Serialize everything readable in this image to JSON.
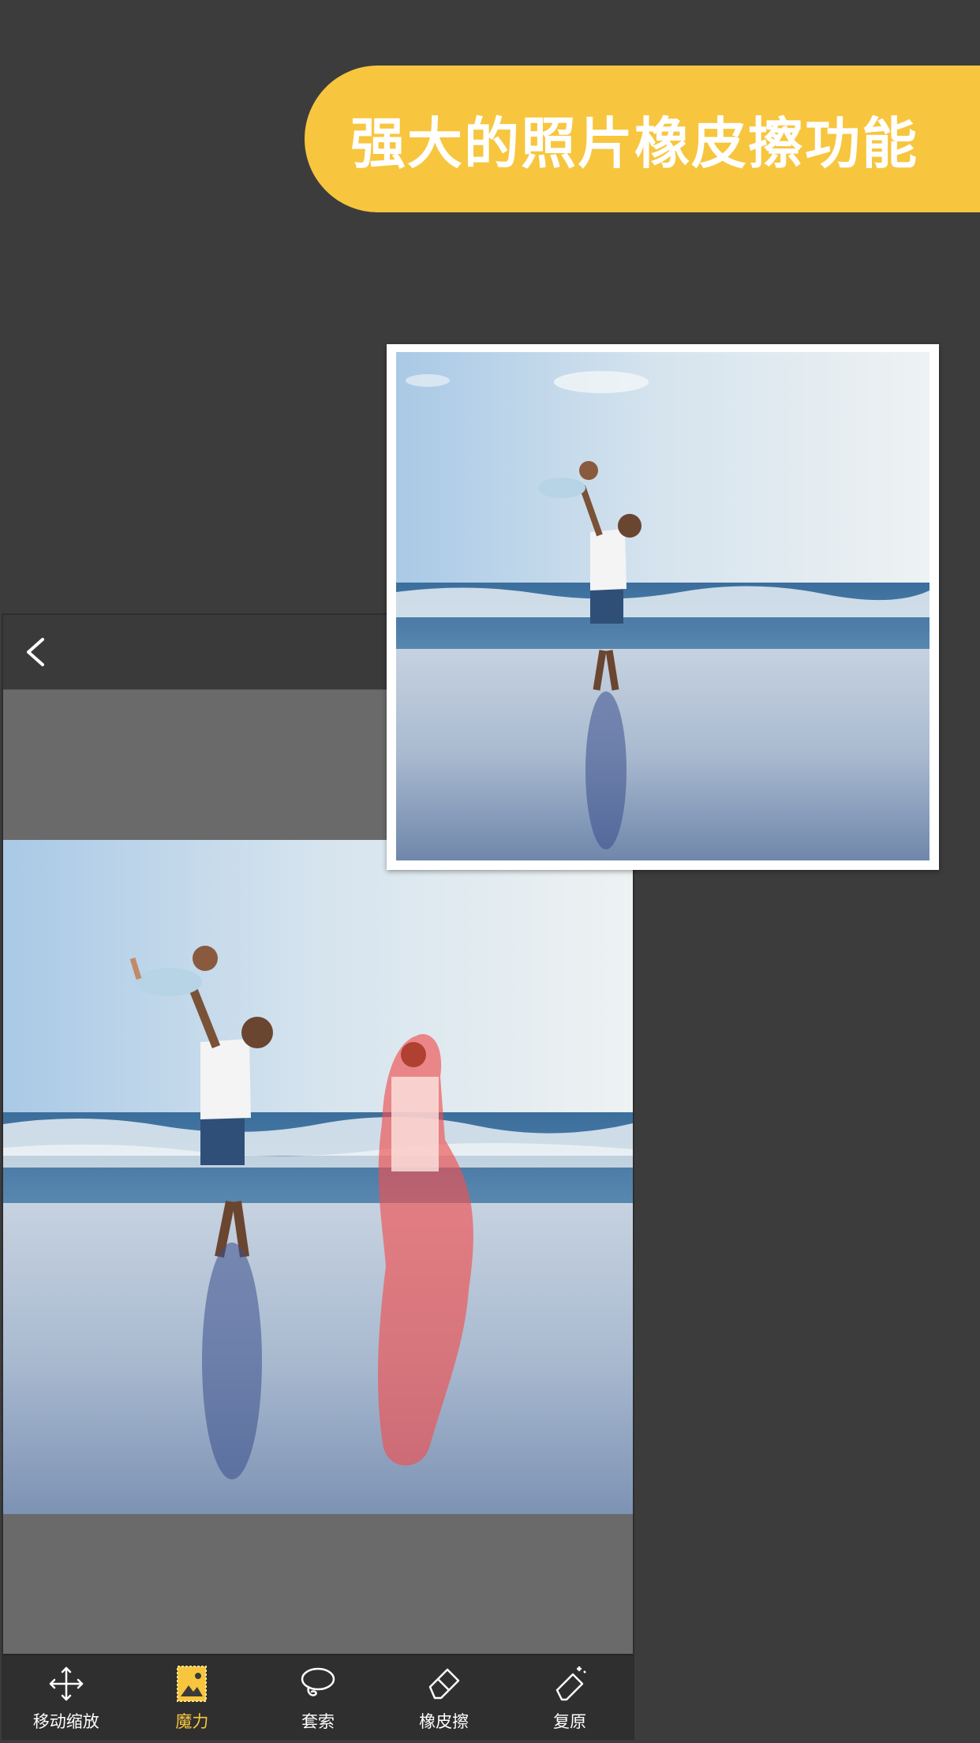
{
  "banner": {
    "title": "强大的照片橡皮擦功能"
  },
  "colors": {
    "accent": "#f7c63e",
    "background": "#3c3c3c",
    "canvas": "#6a6a6a",
    "toolbar": "#2f2f2f",
    "selection": "#f05050"
  },
  "toolbar": {
    "items": [
      {
        "label": "移动缩放",
        "icon": "move-arrows-icon"
      },
      {
        "label": "魔力",
        "icon": "magic-image-icon",
        "active": true
      },
      {
        "label": "套索",
        "icon": "lasso-icon"
      },
      {
        "label": "橡皮擦",
        "icon": "eraser-icon"
      },
      {
        "label": "复原",
        "icon": "restore-icon"
      }
    ]
  }
}
